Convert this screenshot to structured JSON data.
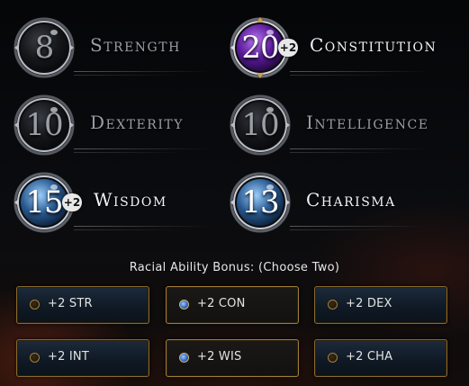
{
  "stats": [
    {
      "name": "Strength",
      "value": "8",
      "bonus": "",
      "active": false,
      "style": "dark"
    },
    {
      "name": "Constitution",
      "value": "20",
      "bonus": "+2",
      "active": true,
      "style": "purple"
    },
    {
      "name": "Dexterity",
      "value": "10",
      "bonus": "",
      "active": false,
      "style": "dark"
    },
    {
      "name": "Intelligence",
      "value": "10",
      "bonus": "",
      "active": false,
      "style": "dark"
    },
    {
      "name": "Wisdom",
      "value": "15",
      "bonus": "+2",
      "active": true,
      "style": "blue"
    },
    {
      "name": "Charisma",
      "value": "13",
      "bonus": "",
      "active": true,
      "style": "blue"
    }
  ],
  "racial": {
    "title": "Racial Ability Bonus: (Choose Two)",
    "options": [
      {
        "label": "+2 STR",
        "selected": false
      },
      {
        "label": "+2 CON",
        "selected": true
      },
      {
        "label": "+2 DEX",
        "selected": false
      },
      {
        "label": "+2 INT",
        "selected": false
      },
      {
        "label": "+2 WIS",
        "selected": true
      },
      {
        "label": "+2 CHA",
        "selected": false
      }
    ]
  },
  "colors": {
    "frame_gold": "#8a6a2c",
    "orb_purple": "#6a2aa0",
    "orb_blue": "#2a5a90",
    "orb_dark": "#1a1c20",
    "selected_dot": "#2a64c0"
  }
}
